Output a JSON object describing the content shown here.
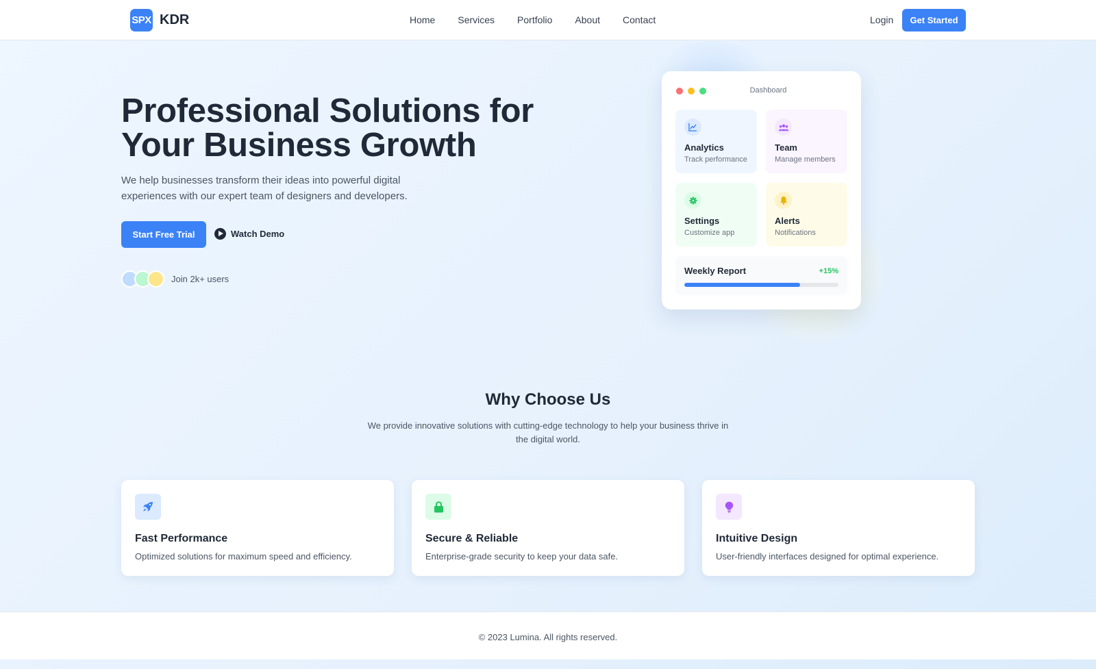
{
  "nav": {
    "logo_mark": "SPX",
    "logo_text": "KDR",
    "links": [
      "Home",
      "Services",
      "Portfolio",
      "About",
      "Contact"
    ],
    "login": "Login",
    "cta": "Get Started"
  },
  "hero": {
    "title_line1": "Professional Solutions for",
    "title_line2": "Your Business Growth",
    "subtitle": "We help businesses transform their ideas into powerful digital experiences with our expert team of designers and developers.",
    "primary_button": "Start Free Trial",
    "secondary_button": "Watch Demo",
    "users_text": "Join 2k+ users",
    "avatar_colors": [
      "#bfdbfe",
      "#bbf7d0",
      "#fde68a"
    ]
  },
  "dashboard": {
    "title": "Dashboard",
    "window_dot_colors": [
      "#f87171",
      "#fbbf24",
      "#4ade80"
    ],
    "tiles": [
      {
        "name": "Analytics",
        "desc": "Track performance",
        "icon": "chart-line-icon",
        "bg": "#eff6ff",
        "icon_bg": "#dbeafe",
        "icon_color": "#3b82f6"
      },
      {
        "name": "Team",
        "desc": "Manage members",
        "icon": "users-icon",
        "bg": "#faf5ff",
        "icon_bg": "#f3e8ff",
        "icon_color": "#a855f7"
      },
      {
        "name": "Settings",
        "desc": "Customize app",
        "icon": "gear-icon",
        "bg": "#f0fdf4",
        "icon_bg": "#dcfce7",
        "icon_color": "#22c55e"
      },
      {
        "name": "Alerts",
        "desc": "Notifications",
        "icon": "bell-icon",
        "bg": "#fefce8",
        "icon_bg": "#fef3c7",
        "icon_color": "#eab308"
      }
    ],
    "report": {
      "title": "Weekly Report",
      "change": "+15%",
      "progress": 0.75
    }
  },
  "why": {
    "title": "Why Choose Us",
    "subtitle": "We provide innovative solutions with cutting-edge technology to help your business thrive in the digital world.",
    "features": [
      {
        "title": "Fast Performance",
        "desc": "Optimized solutions for maximum speed and efficiency.",
        "icon": "rocket-icon",
        "icon_bg": "#dbeafe",
        "icon_color": "#3b82f6"
      },
      {
        "title": "Secure & Reliable",
        "desc": "Enterprise-grade security to keep your data safe.",
        "icon": "lock-icon",
        "icon_bg": "#dcfce7",
        "icon_color": "#22c55e"
      },
      {
        "title": "Intuitive Design",
        "desc": "User-friendly interfaces designed for optimal experience.",
        "icon": "lightbulb-icon",
        "icon_bg": "#f3e8ff",
        "icon_color": "#a855f7"
      }
    ]
  },
  "footer": {
    "text": "© 2023 Lumina. All rights reserved."
  },
  "colors": {
    "accent": "#3b82f6",
    "text": "#1f2937"
  }
}
